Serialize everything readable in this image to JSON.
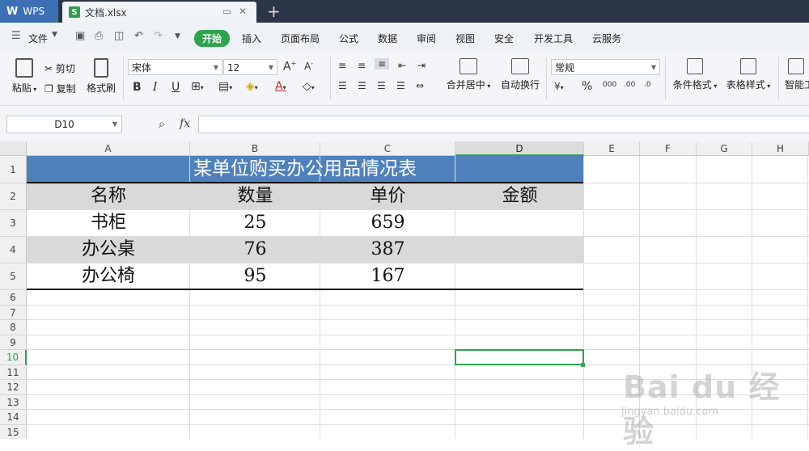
{
  "tabs": {
    "app_label": "WPS",
    "doc_name": "文档.xlsx",
    "new_tab": "+"
  },
  "menu": {
    "file": "文件",
    "items": [
      "开始",
      "插入",
      "页面布局",
      "公式",
      "数据",
      "审阅",
      "视图",
      "安全",
      "开发工具",
      "云服务"
    ],
    "active": "开始"
  },
  "ribbon": {
    "paste": "粘贴",
    "cut": "剪切",
    "copy": "复制",
    "format_painter": "格式刷",
    "font_name": "宋体",
    "font_size": "12",
    "bold": "B",
    "italic": "I",
    "underline": "U",
    "merge_center": "合并居中",
    "wrap_text": "自动换行",
    "number_format": "常规",
    "percent": "%",
    "cond_format": "条件格式",
    "table_style": "表格样式",
    "smart": "智能工"
  },
  "formula_bar": {
    "name_box": "D10",
    "fx": "fx",
    "formula": ""
  },
  "columns": [
    "A",
    "B",
    "C",
    "D",
    "E",
    "F",
    "G",
    "H"
  ],
  "selected_column": "D",
  "rows": [
    "1",
    "2",
    "3",
    "4",
    "5",
    "6",
    "7",
    "8",
    "9",
    "10",
    "11",
    "12",
    "13",
    "14",
    "15"
  ],
  "selected_row": "10",
  "table": {
    "title": "某单位购买办公用品情况表",
    "headers": [
      "名称",
      "数量",
      "单价",
      "金额"
    ],
    "data": [
      [
        "书柜",
        "25",
        "659",
        ""
      ],
      [
        "办公桌",
        "76",
        "387",
        ""
      ],
      [
        "办公椅",
        "95",
        "167",
        ""
      ]
    ]
  },
  "colors": {
    "title_fill": "#4f81bd",
    "band_fill": "#d9d9d9",
    "accent": "#2ea44f"
  },
  "watermark": {
    "brand": "Bai du 经验",
    "url": "jingyan.baidu.com"
  }
}
